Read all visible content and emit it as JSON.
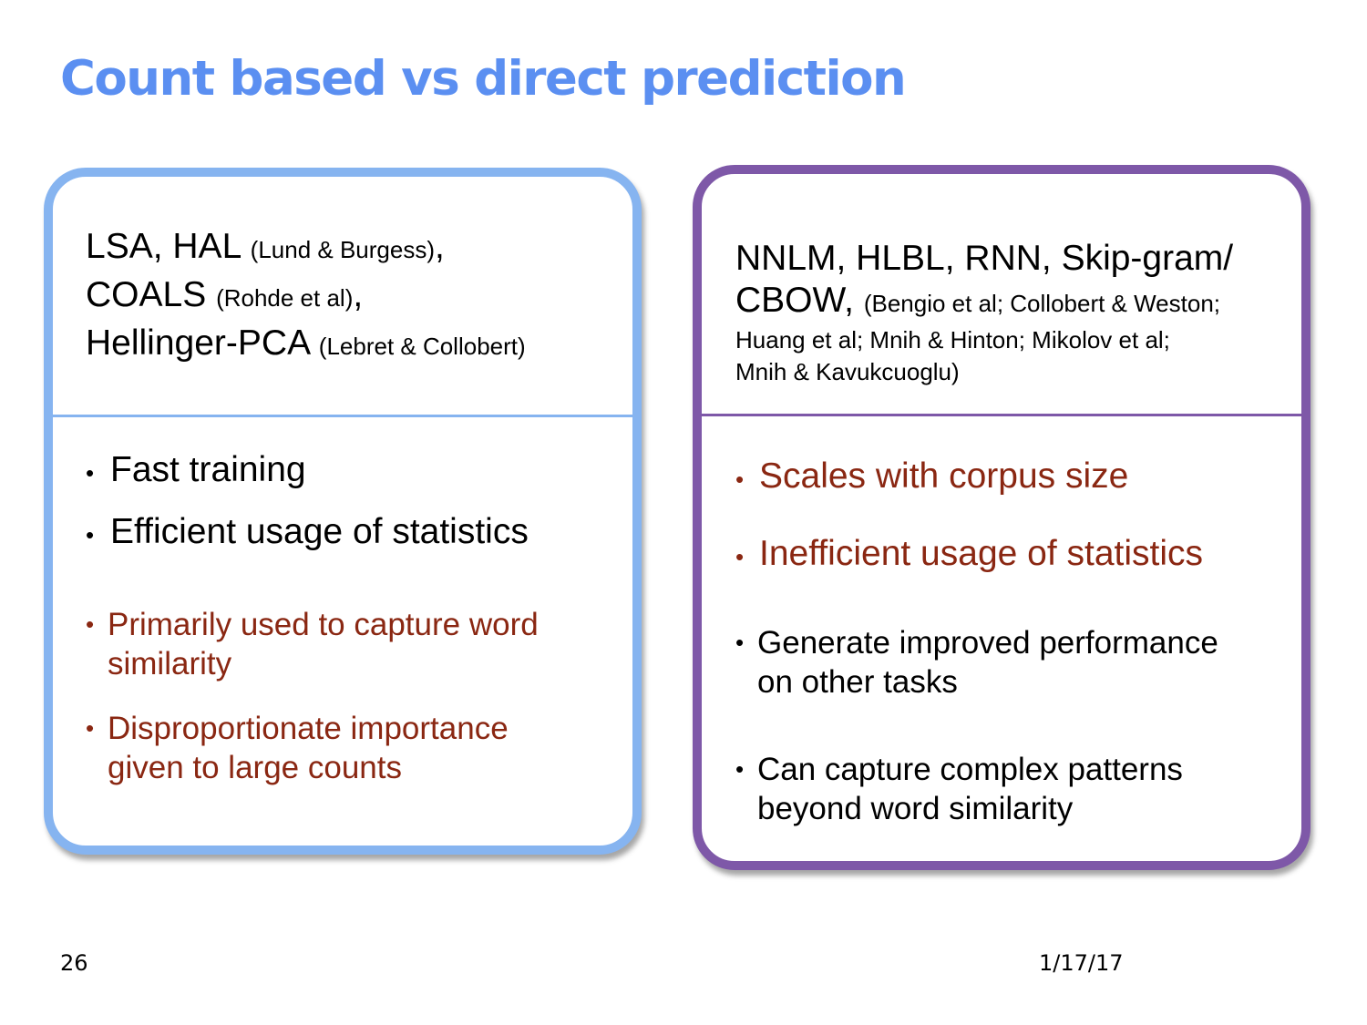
{
  "slide": {
    "title": "Count based vs direct prediction",
    "page_number": "26",
    "date": "1/17/17"
  },
  "left_panel": {
    "heading": [
      {
        "main": "LSA, HAL ",
        "cite": "(Lund & Burgess)",
        "tail": ","
      },
      {
        "main": "COALS ",
        "cite": "(Rohde et al)",
        "tail": ","
      },
      {
        "main": "Hellinger-PCA ",
        "cite": "(Lebret & Collobert)",
        "tail": ""
      }
    ],
    "bullets": [
      {
        "text": "Fast training",
        "color": "#000000"
      },
      {
        "text": "Efficient usage of statistics",
        "color": "#000000"
      },
      {
        "line1": "Primarily used to capture word",
        "line2": "similarity",
        "color": "#8a2712"
      },
      {
        "line1": "Disproportionate importance",
        "line2": "given to large counts",
        "color": "#8a2712"
      }
    ],
    "border_color": "#86b4f0"
  },
  "right_panel": {
    "heading": {
      "line1": "NNLM, HLBL, RNN, Skip-gram/",
      "line2_main": "CBOW, ",
      "line2_cite": "(Bengio et al; Collobert & Weston;",
      "line3": "Huang et al; Mnih & Hinton; Mikolov et al;",
      "line4": "Mnih & Kavukcuoglu)"
    },
    "bullets": [
      {
        "text": "Scales with corpus size",
        "color": "#8a2712"
      },
      {
        "text": "Inefficient usage of statistics",
        "color": "#8a2712"
      },
      {
        "line1": "Generate improved performance",
        "line2": "on other tasks",
        "color": "#000000"
      },
      {
        "line1": "Can capture complex patterns",
        "line2": "beyond word similarity",
        "color": "#000000"
      }
    ],
    "border_color": "#7e58a8"
  },
  "bullet_glyph": "•"
}
